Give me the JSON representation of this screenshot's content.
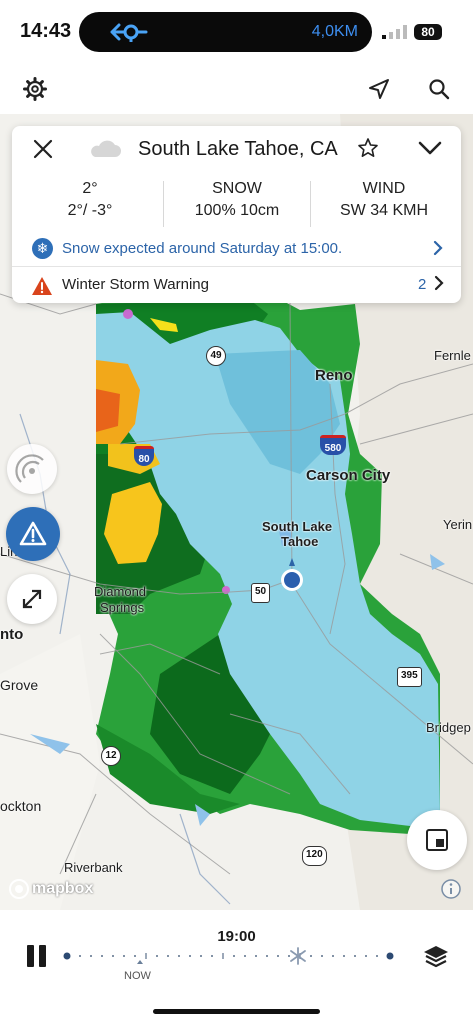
{
  "status_bar": {
    "time": "14:43",
    "speed": "4,0KM",
    "battery": "80"
  },
  "toolbar": {
    "settings_icon": "gear-icon",
    "location_icon": "location-arrow-icon",
    "search_icon": "search-icon"
  },
  "card": {
    "place": "South Lake Tahoe, CA",
    "condition_icon": "cloud-icon",
    "temperature": {
      "current": "2°",
      "range": "2°/ -3°"
    },
    "precip": {
      "label": "SNOW",
      "value": "100% 10cm"
    },
    "wind": {
      "label": "WIND",
      "value": "SW 34 KMH"
    },
    "snow_notice": "Snow expected around Saturday at 15:00.",
    "warning": {
      "label": "Winter Storm Warning",
      "count": "2"
    }
  },
  "map": {
    "cities": {
      "reno": "Reno",
      "carson": "Carson City",
      "tahoe_1": "South Lake",
      "tahoe_2": "Tahoe",
      "diamond_1": "Diamond",
      "diamond_2": "Springs",
      "fernley": "Fernle",
      "yerington": "Yerin",
      "lincoln": "Lin",
      "sacramento": "nto",
      "elk_grove": "Grove",
      "stockton": "ockton",
      "riverbank": "Riverbank",
      "bridgeport": "Bridgep"
    },
    "shields": {
      "r49": "49",
      "i80": "80",
      "i580": "580",
      "us50": "50",
      "us395": "395",
      "r12": "12",
      "r120": "120"
    },
    "attribution": "mapbox"
  },
  "timeline": {
    "time": "19:00",
    "now_label": "NOW"
  },
  "colors": {
    "accent_blue": "#2c64a8",
    "warning_red": "#d9441c",
    "snow_blue": "#8fd3e6"
  }
}
